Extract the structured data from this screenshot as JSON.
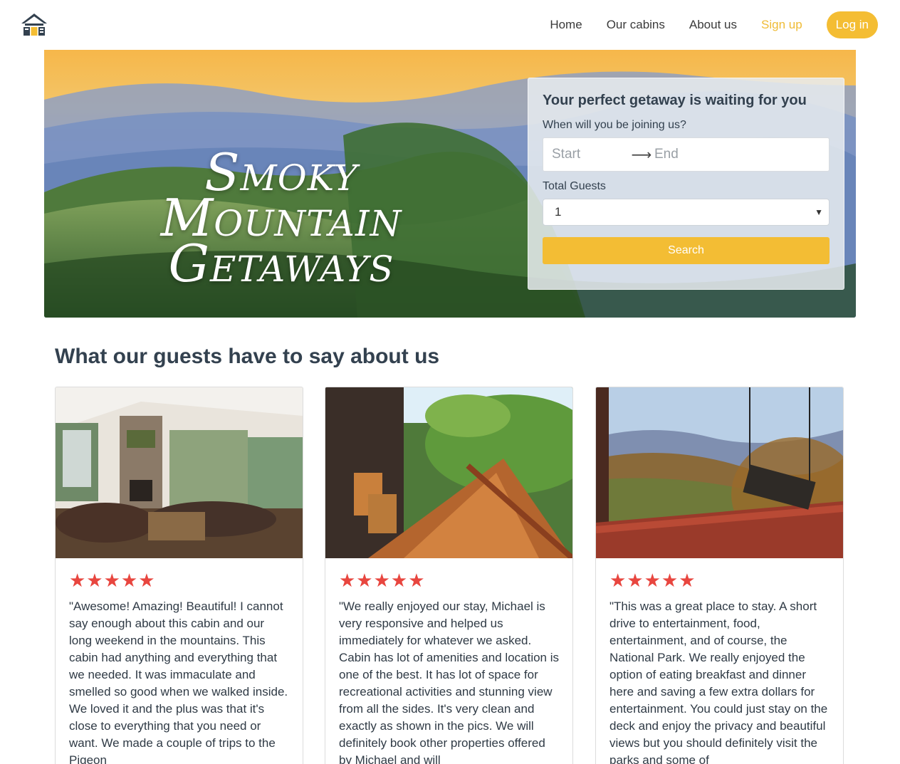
{
  "nav": {
    "links": [
      "Home",
      "Our cabins",
      "About us"
    ],
    "signup": "Sign up",
    "login": "Log in"
  },
  "hero": {
    "title_line1": "Smoky Mountain",
    "title_line2": "Getaways"
  },
  "search": {
    "heading": "Your perfect getaway is waiting for you",
    "date_label": "When will you be joining us?",
    "start_placeholder": "Start",
    "end_placeholder": "End",
    "guests_label": "Total Guests",
    "guests_value": "1",
    "button": "Search"
  },
  "reviews": {
    "title": "What our guests have to say about us",
    "items": [
      {
        "rating": 5,
        "stars": "★★★★★",
        "text": "\"Awesome! Amazing! Beautiful! I cannot say enough about this cabin and our long weekend in the mountains. This cabin had anything and everything that we needed. It was immaculate and smelled so good when we walked inside. We loved it and the plus was that it's close to everything that you need or want. We made a couple of trips to the Pigeon"
      },
      {
        "rating": 5,
        "stars": "★★★★★",
        "text": "\"We really enjoyed our stay, Michael is very responsive and helped us immediately for whatever we asked. Cabin has lot of amenities and location is one of the best. It has lot of space for recreational activities and stunning view from all the sides. It's very clean and exactly as shown in the pics. We will definitely book other properties offered by Michael and will"
      },
      {
        "rating": 5,
        "stars": "★★★★★",
        "text": "\"This was a great place to stay. A short drive to entertainment, food, entertainment, and of course, the National Park. We really enjoyed the option of eating breakfast and dinner here and saving a few extra dollars for entertainment. You could just stay on the deck and enjoy the privacy and beautiful views but you should definitely visit the parks and some of"
      }
    ]
  },
  "colors": {
    "accent": "#f4bd33",
    "star": "#e8463f",
    "heading": "#33414f"
  }
}
